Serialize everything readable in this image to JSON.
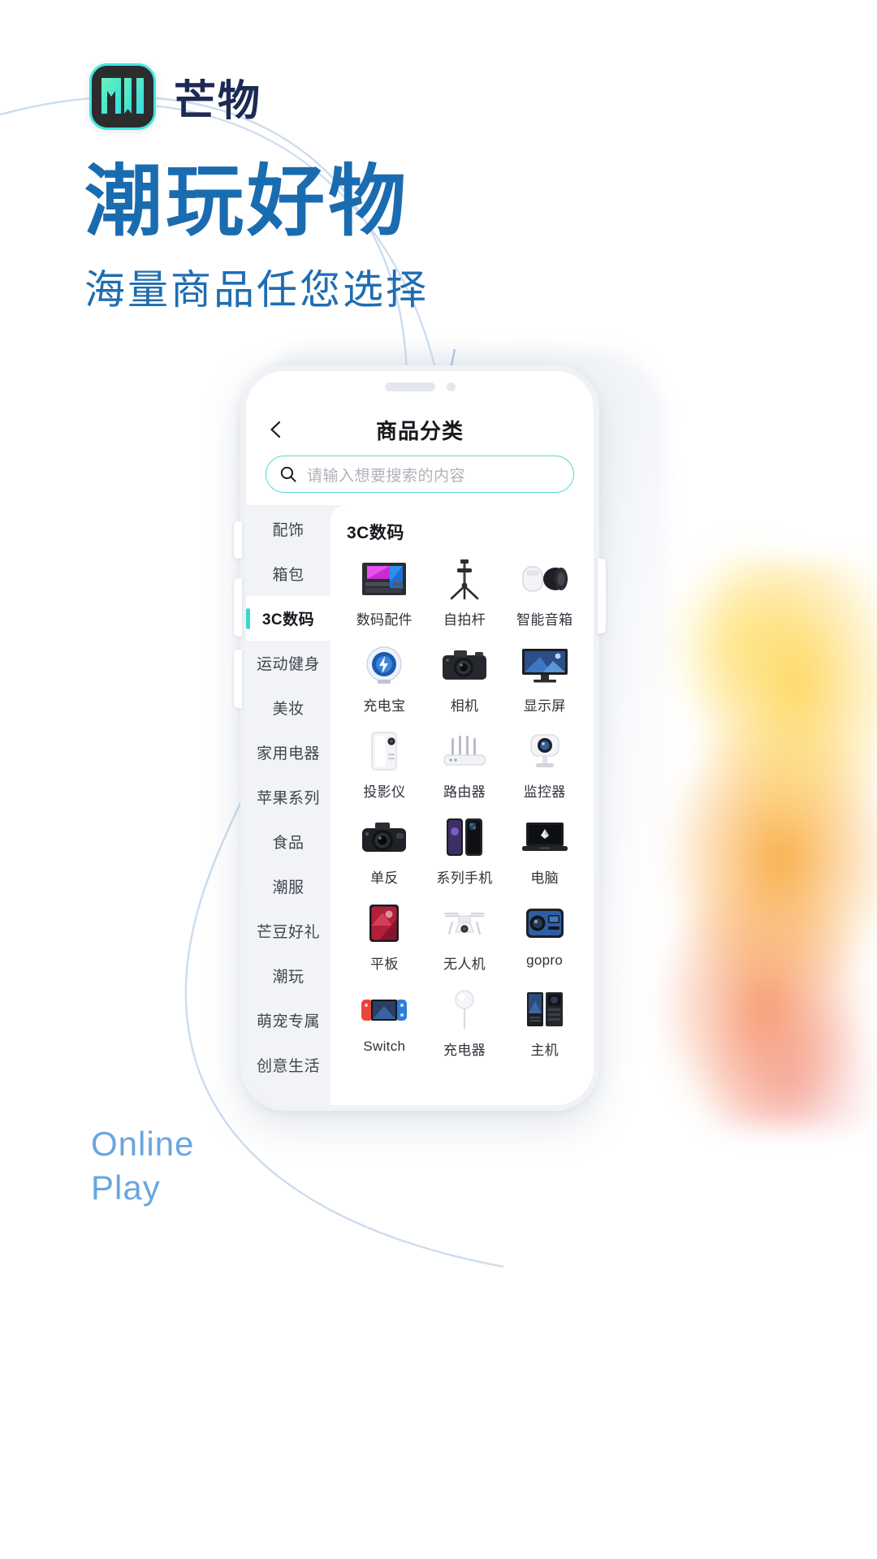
{
  "brand": {
    "logo_icon": "mw-monogram-logo",
    "name": "芒物",
    "logo_bg": "#2c2c2e",
    "logo_accent": "#3ee8e0"
  },
  "headline": {
    "main": "潮玩好物",
    "sub": "海量商品任您选择",
    "main_color": "#1a6cb0",
    "sub_color": "#1f6db2"
  },
  "footer": {
    "line1": "Online",
    "line2": "Play",
    "color": "#6aa6e0"
  },
  "phone": {
    "header": {
      "back_icon": "chevron-left-icon",
      "title": "商品分类"
    },
    "search": {
      "icon": "search-icon",
      "placeholder": "请输入想要搜索的内容",
      "value": "",
      "border_color": "#58ddd0"
    },
    "sidebar": {
      "active_index": 2,
      "accent_color": "#3ed6c8",
      "items": [
        {
          "label": "配饰"
        },
        {
          "label": "箱包"
        },
        {
          "label": "3C数码"
        },
        {
          "label": "运动健身"
        },
        {
          "label": "美妆"
        },
        {
          "label": "家用电器"
        },
        {
          "label": "苹果系列"
        },
        {
          "label": "食品"
        },
        {
          "label": "潮服"
        },
        {
          "label": "芒豆好礼"
        },
        {
          "label": "潮玩"
        },
        {
          "label": "萌宠专属"
        },
        {
          "label": "创意生活"
        }
      ]
    },
    "content": {
      "title": "3C数码",
      "items": [
        {
          "label": "数码配件",
          "icon": "motherboard-icon"
        },
        {
          "label": "自拍杆",
          "icon": "selfie-stick-icon"
        },
        {
          "label": "智能音箱",
          "icon": "smart-speaker-icon"
        },
        {
          "label": "充电宝",
          "icon": "power-bank-icon"
        },
        {
          "label": "相机",
          "icon": "camera-icon"
        },
        {
          "label": "显示屏",
          "icon": "monitor-icon"
        },
        {
          "label": "投影仪",
          "icon": "projector-icon"
        },
        {
          "label": "路由器",
          "icon": "router-icon"
        },
        {
          "label": "监控器",
          "icon": "security-camera-icon"
        },
        {
          "label": "单反",
          "icon": "dslr-icon"
        },
        {
          "label": "系列手机",
          "icon": "phone-icon"
        },
        {
          "label": "电脑",
          "icon": "laptop-icon"
        },
        {
          "label": "平板",
          "icon": "tablet-icon"
        },
        {
          "label": "无人机",
          "icon": "drone-icon"
        },
        {
          "label": "gopro",
          "icon": "action-cam-icon"
        },
        {
          "label": "Switch",
          "icon": "game-console-icon"
        },
        {
          "label": "充电器",
          "icon": "charger-icon"
        },
        {
          "label": "主机",
          "icon": "desktop-tower-icon"
        }
      ]
    }
  }
}
